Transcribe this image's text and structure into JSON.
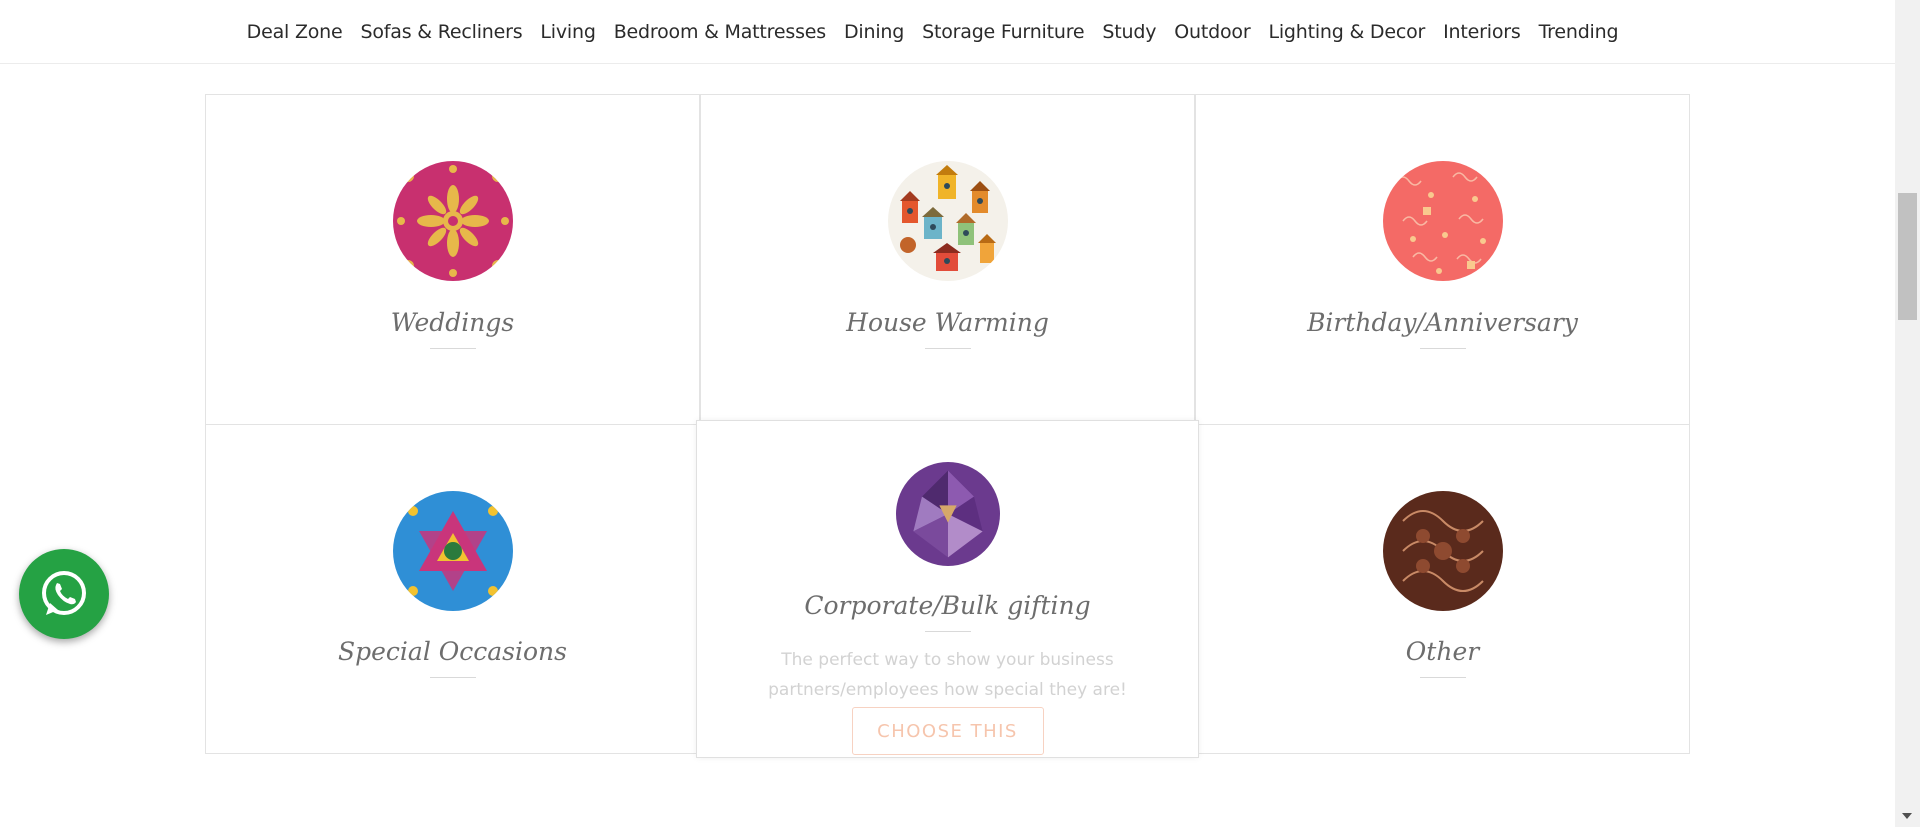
{
  "nav": {
    "items": [
      "Deal Zone",
      "Sofas & Recliners",
      "Living",
      "Bedroom & Mattresses",
      "Dining",
      "Storage Furniture",
      "Study",
      "Outdoor",
      "Lighting & Decor",
      "Interiors",
      "Trending"
    ]
  },
  "occasions": [
    {
      "label": "Weddings",
      "icon": "weddings-pattern-icon"
    },
    {
      "label": "House Warming",
      "icon": "birdhouses-pattern-icon"
    },
    {
      "label": "Birthday/Anniversary",
      "icon": "birthday-pattern-icon"
    },
    {
      "label": "Special Occasions",
      "icon": "kaleidoscope-pattern-icon"
    },
    {
      "label": "Corporate/Bulk gifting",
      "icon": "crystal-pattern-icon",
      "description": "The perfect way to show your business partners/employees how special they are!",
      "button": "CHOOSE THIS"
    },
    {
      "label": "Other",
      "icon": "paisley-pattern-icon"
    }
  ],
  "colors": {
    "whatsapp": "#25a244",
    "choose_button_text": "#f6c5ad",
    "label": "#6d6d6d"
  }
}
